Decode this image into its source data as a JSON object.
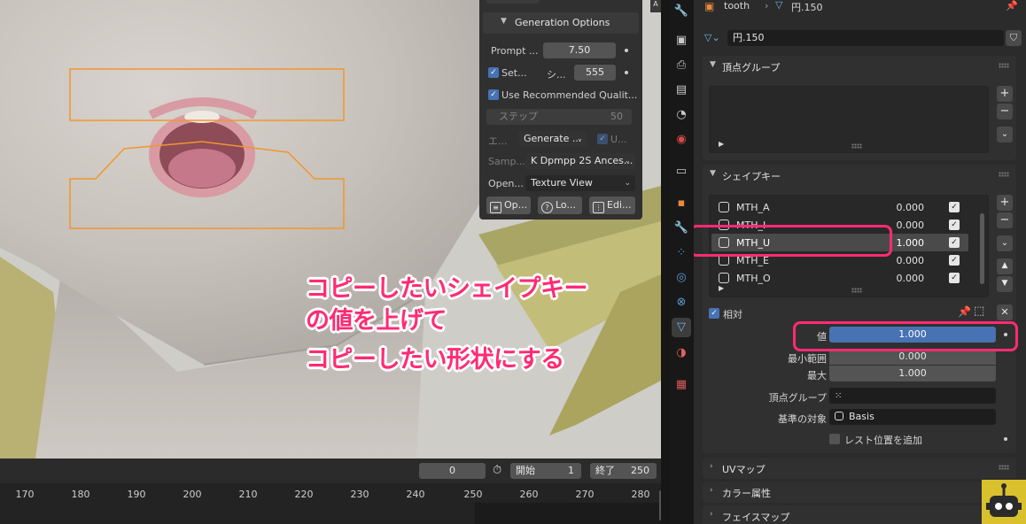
{
  "gen_options": {
    "header": "Generation Options",
    "prompt_label": "Prompt ...",
    "prompt_value": "7.50",
    "seed_label": "Set...",
    "seed_sub_label": "シ...",
    "seed_value": "555",
    "recommended_label": "Use Recommended Qualit...",
    "steps_label": "ステップ",
    "steps_value": "50",
    "engine_label": "エ...",
    "engine_value": "Generate ...",
    "engine_u_label": "U...",
    "sampler_label": "Samp...",
    "sampler_value": "K Dpmpp 2S Ances...",
    "open_label": "Open...",
    "open_value": "Texture View",
    "btn_op": "Op...",
    "btn_lo": "Lo...",
    "btn_edi": "Edi..."
  },
  "annotation": {
    "line1": "コピーしたいシェイプキー",
    "line2": "の値を上げて",
    "line3": "コピーしたい形状にする"
  },
  "timeline": {
    "current_frame": "0",
    "start_label": "開始",
    "start_value": "1",
    "end_label": "終了",
    "end_value": "250",
    "ticks": [
      "170",
      "180",
      "190",
      "200",
      "210",
      "220",
      "230",
      "240",
      "250",
      "260",
      "270",
      "280"
    ]
  },
  "n_tab_label": "A",
  "properties": {
    "breadcrumb_object": "tooth",
    "breadcrumb_mesh": "円.150",
    "mesh_name": "円.150",
    "vertex_groups_header": "頂点グループ",
    "shape_keys_header": "シェイプキー",
    "shape_keys": [
      {
        "name": "MTH_A",
        "value": "0.000",
        "selected": false
      },
      {
        "name": "MTH_I",
        "value": "0.000",
        "selected": false
      },
      {
        "name": "MTH_U",
        "value": "1.000",
        "selected": true
      },
      {
        "name": "MTH_E",
        "value": "0.000",
        "selected": false
      },
      {
        "name": "MTH_O",
        "value": "0.000",
        "selected": false
      }
    ],
    "relative_label": "相対",
    "value_label": "値",
    "value_value": "1.000",
    "min_label": "最小範囲",
    "min_value": "0.000",
    "max_label": "最大",
    "max_value": "1.000",
    "vertex_group_label": "頂点グループ",
    "relative_to_label": "基準の対象",
    "relative_to_value": "Basis",
    "add_rest_label": "レスト位置を追加",
    "uv_maps_header": "UVマップ",
    "color_attr_header": "カラー属性",
    "face_maps_header": "フェイスマップ"
  },
  "colors": {
    "annotation": "#ff2b73",
    "accent_blue": "#4772b3",
    "highlight_orange": "#f0962e"
  }
}
